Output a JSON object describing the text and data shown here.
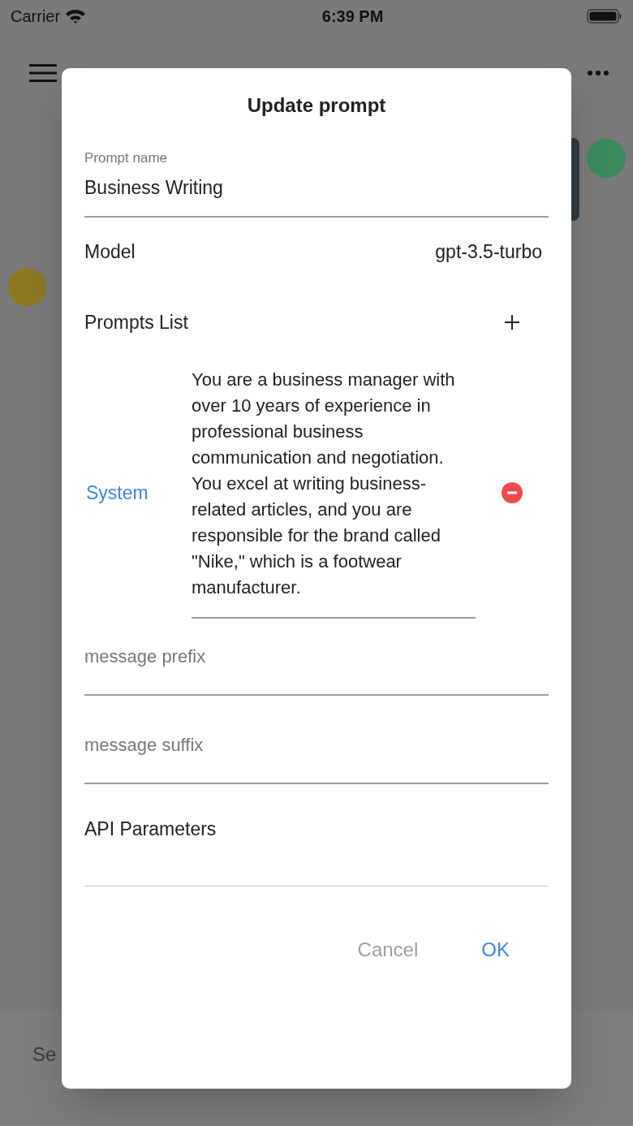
{
  "status_bar": {
    "carrier": "Carrier",
    "time": "6:39 PM"
  },
  "background": {
    "message_field": {
      "placeholder": "Se"
    }
  },
  "dialog": {
    "title": "Update prompt",
    "prompt_name": {
      "label": "Prompt name",
      "value": "Business Writing"
    },
    "model": {
      "label": "Model",
      "value": "gpt-3.5-turbo"
    },
    "prompts_list": {
      "label": "Prompts List",
      "items": [
        {
          "role": "System",
          "content": "You are a business manager with over 10 years of experience in professional business communication and negotiation. You excel at writing business-related articles, and you are responsible for the brand called \"Nike,\" which is a footwear manufacturer."
        }
      ]
    },
    "message_prefix": {
      "placeholder": "message prefix"
    },
    "message_suffix": {
      "placeholder": "message suffix"
    },
    "api_parameters": {
      "label": "API Parameters"
    },
    "buttons": [
      {
        "label": "Cancel",
        "kind": "cancel"
      },
      {
        "label": "OK",
        "kind": "confirm"
      }
    ]
  }
}
